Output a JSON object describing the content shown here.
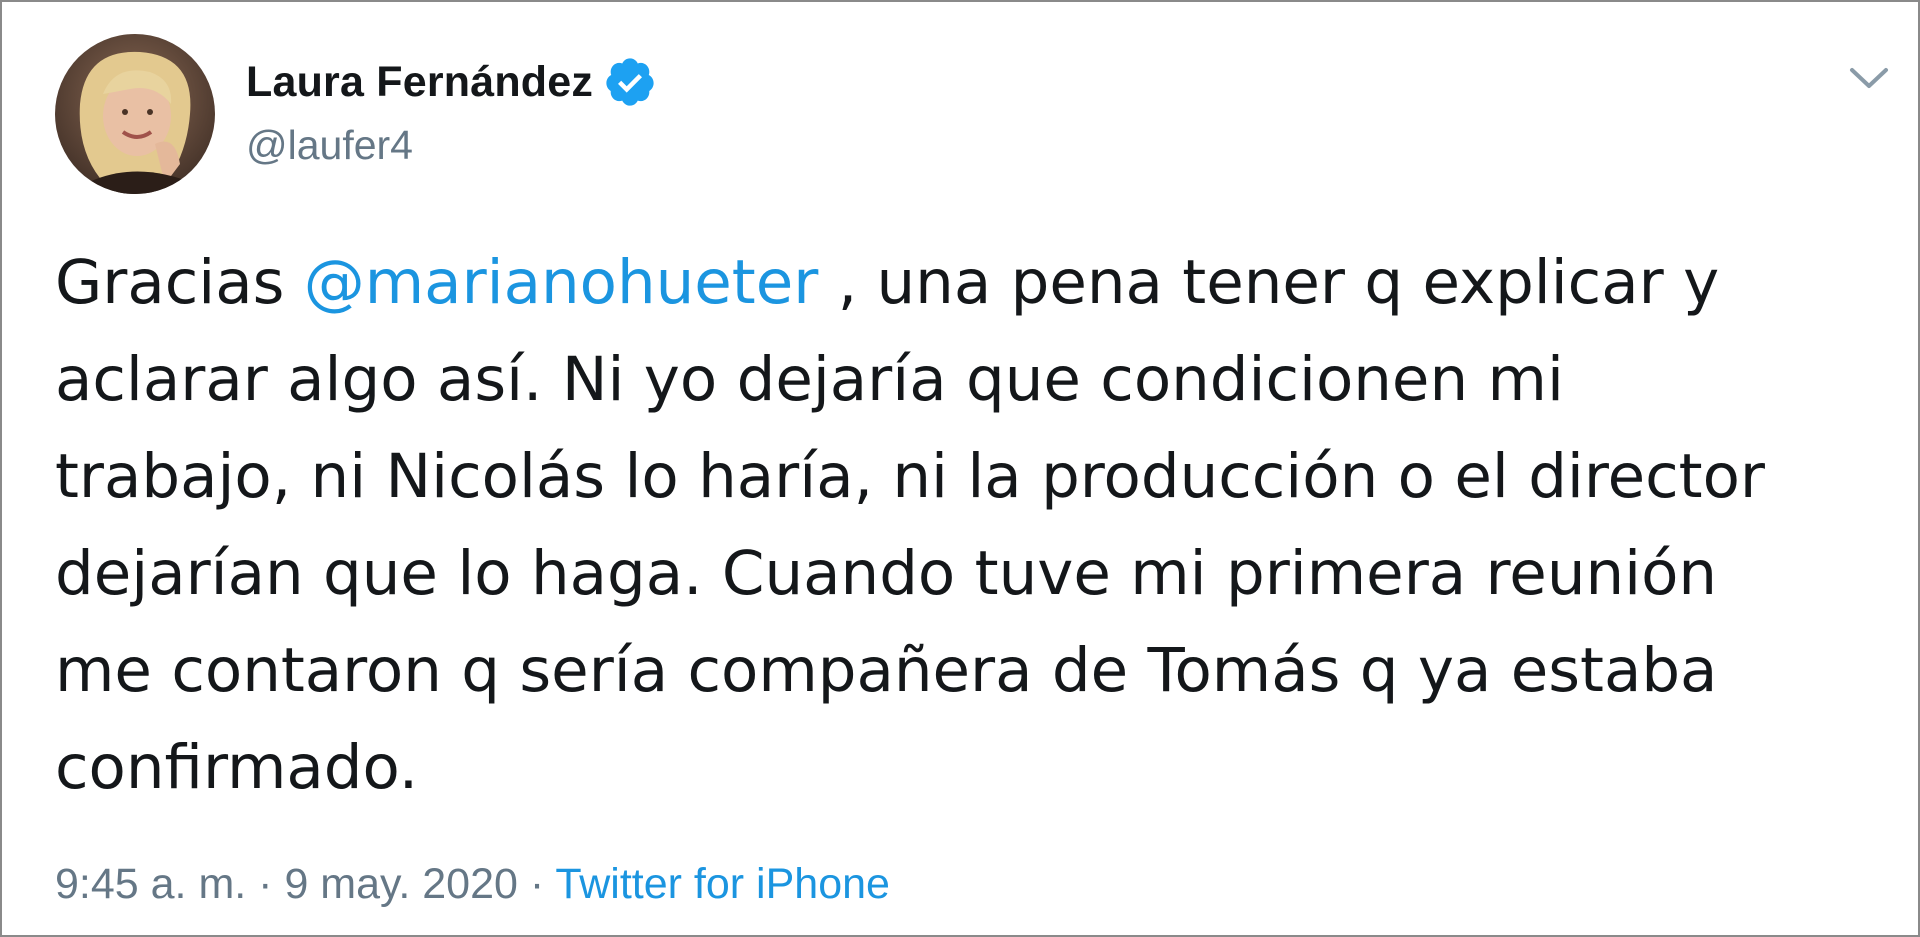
{
  "user": {
    "display_name": "Laura Fernández",
    "handle": "@laufer4",
    "verified_icon": "verified-badge-icon",
    "avatar_icon": "profile-photo"
  },
  "menu": {
    "caret_icon": "chevron-down-icon"
  },
  "tweet": {
    "line1_prefix": "Gracias ",
    "mention": "@marianohueter",
    "line1_suffix": " , una pena tener q explicar y",
    "line2": "aclarar algo así. Ni yo dejaría que condicionen mi",
    "line3": "trabajo, ni Nicolás lo haría, ni la producción o el director",
    "line4": "dejarían que lo haga. Cuando tuve mi primera reunión",
    "line5": "me contaron q sería compañera de Tomás q ya estaba",
    "line6": "confirmado."
  },
  "meta": {
    "time": "9:45 a. m.",
    "separator1": " · ",
    "date": "9 may. 2020",
    "separator2": " · ",
    "source": "Twitter for iPhone"
  },
  "colors": {
    "link": "#1b95e0",
    "secondary_text": "#657786",
    "primary_text": "#14171a",
    "verified": "#1da1f2"
  }
}
